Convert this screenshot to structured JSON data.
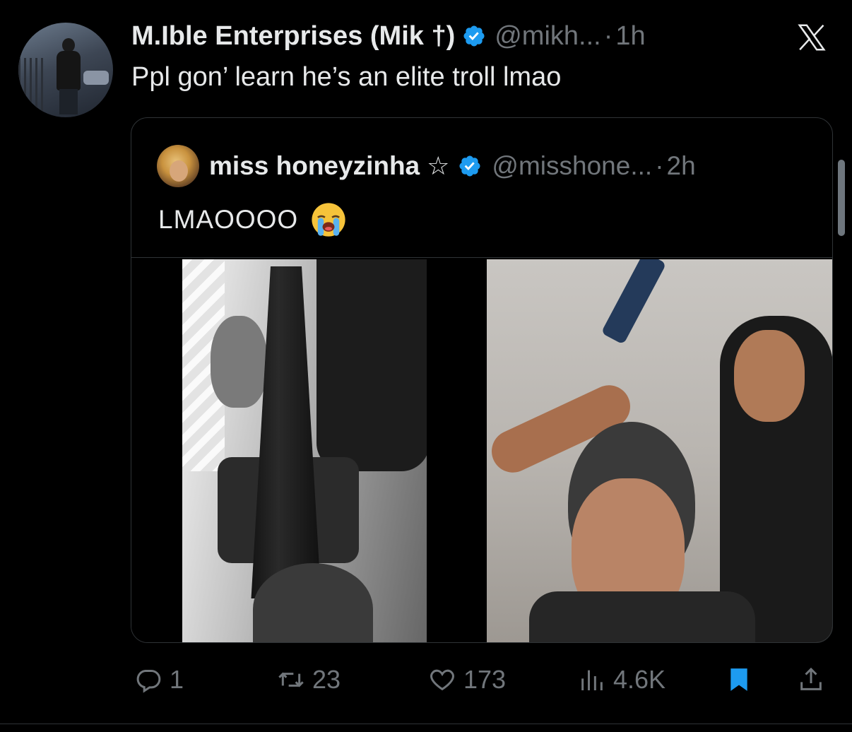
{
  "tweet": {
    "display_name": "M.Ible Enterprises (Mik †)",
    "handle": "@mikh...",
    "separator": "·",
    "time": "1h",
    "text": "Ppl gon’ learn he’s an elite troll lmao",
    "verified_color": "#1d9bf0"
  },
  "quoted_tweet": {
    "display_name": "miss honeyzinha",
    "star": "☆",
    "handle": "@misshone...",
    "separator": "·",
    "time": "2h",
    "text": "LMAOOOO",
    "emoji": "loudly-crying-face"
  },
  "actions": {
    "replies": "1",
    "reposts": "23",
    "likes": "173",
    "views": "4.6K",
    "bookmark_color": "#1d9bf0"
  },
  "colors": {
    "background": "#000000",
    "primary_text": "#e7e9ea",
    "secondary_text": "#71767b",
    "border": "#2f3336"
  }
}
